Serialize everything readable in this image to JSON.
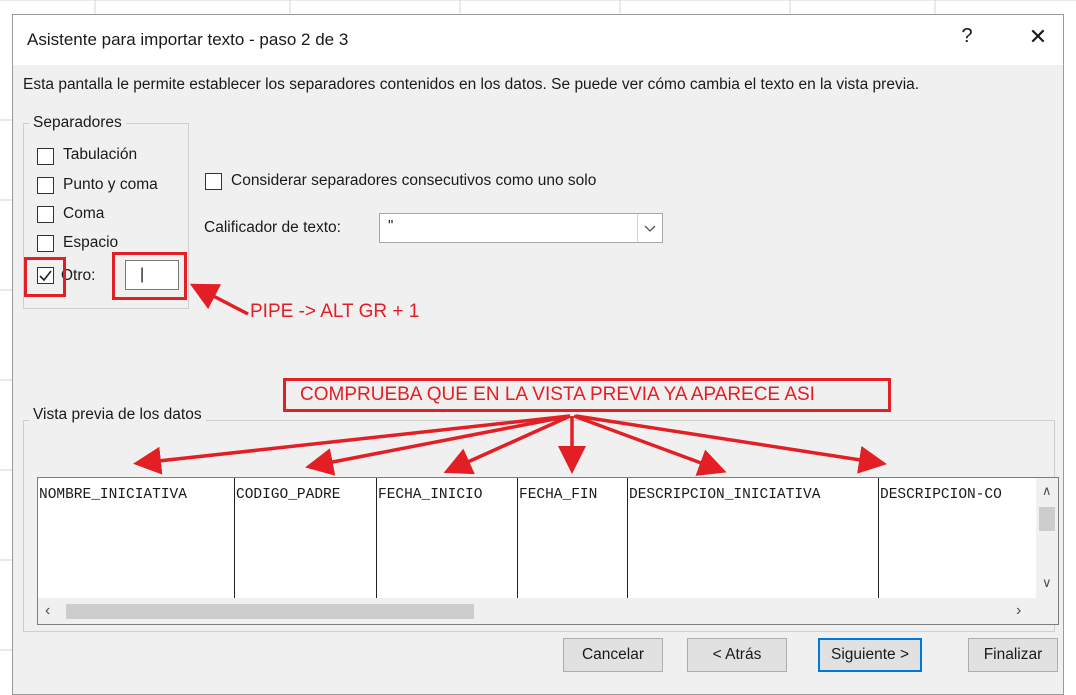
{
  "window": {
    "title": "Asistente para importar texto - paso 2 de 3",
    "help_label": "?",
    "close_label": "✕"
  },
  "description": "Esta pantalla le permite establecer los separadores contenidos en los datos. Se puede ver cómo cambia el texto en la vista previa.",
  "separators": {
    "legend": "Separadores",
    "tab": "Tabulación",
    "semicolon": "Punto y coma",
    "comma": "Coma",
    "space": "Espacio",
    "other": "Otro:",
    "other_value": "|",
    "other_checked": true
  },
  "consecutive_label": "Considerar separadores consecutivos como uno solo",
  "qualifier": {
    "label": "Calificador de texto:",
    "value": "\""
  },
  "preview": {
    "legend": "Vista previa de los datos",
    "columns": [
      "NOMBRE_INICIATIVA",
      "CODIGO_PADRE",
      "FECHA_INICIO",
      "FECHA_FIN",
      "DESCRIPCION_INICIATIVA",
      "DESCRIPCION-CO"
    ]
  },
  "buttons": {
    "cancel": "Cancelar",
    "back": "< Atrás",
    "next": "Siguiente >",
    "finish": "Finalizar"
  },
  "annotations": {
    "pipe_note": "PIPE -> ALT GR + 1",
    "preview_note": "COMPRUEBA QUE EN LA VISTA PREVIA YA APARECE ASI",
    "color": "#e31e24"
  }
}
